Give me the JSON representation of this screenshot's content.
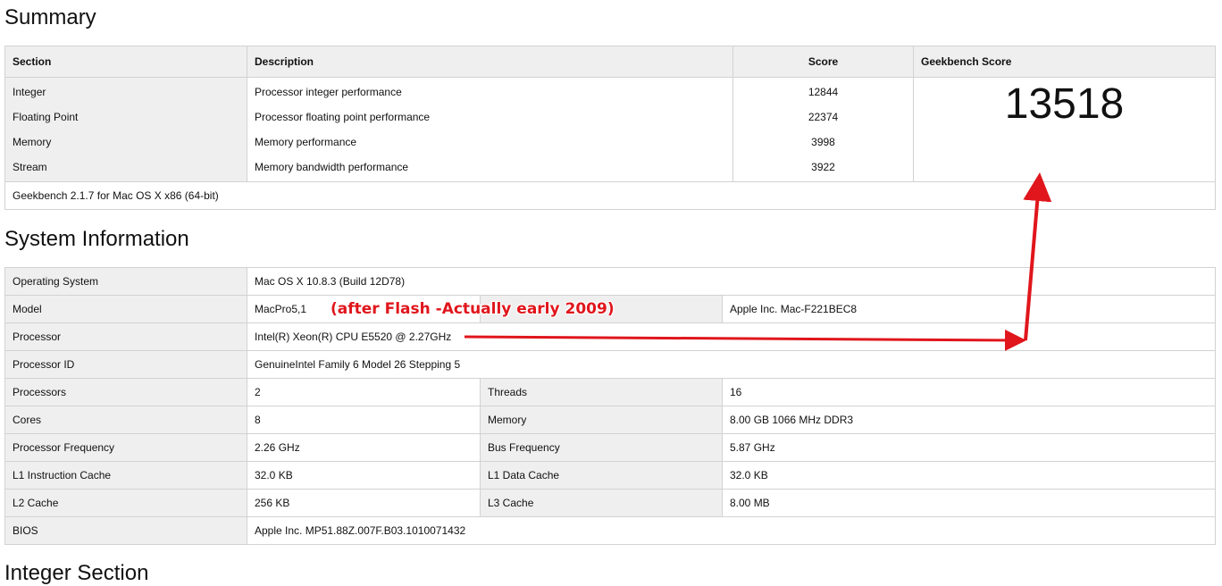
{
  "summary": {
    "heading": "Summary",
    "columns": {
      "section": "Section",
      "description": "Description",
      "score": "Score",
      "geekbench_score": "Geekbench Score"
    },
    "rows": [
      {
        "section": "Integer",
        "description": "Processor integer performance",
        "score": "12844"
      },
      {
        "section": "Floating Point",
        "description": "Processor floating point performance",
        "score": "22374"
      },
      {
        "section": "Memory",
        "description": "Memory performance",
        "score": "3998"
      },
      {
        "section": "Stream",
        "description": "Memory bandwidth performance",
        "score": "3922"
      }
    ],
    "geekbench_score": "13518",
    "footer": "Geekbench 2.1.7 for Mac OS X x86 (64-bit)"
  },
  "system_info": {
    "heading": "System Information",
    "operating_system": {
      "label": "Operating System",
      "value": "Mac OS X 10.8.3 (Build 12D78)"
    },
    "model": {
      "label": "Model",
      "value": "MacPro5,1",
      "value2": "Apple Inc. Mac-F221BEC8"
    },
    "processor": {
      "label": "Processor",
      "value": "Intel(R) Xeon(R) CPU E5520 @ 2.27GHz"
    },
    "processor_id": {
      "label": "Processor ID",
      "value": "GenuineIntel Family 6 Model 26 Stepping 5"
    },
    "pairs": [
      {
        "label": "Processors",
        "value": "2",
        "label2": "Threads",
        "value2": "16"
      },
      {
        "label": "Cores",
        "value": "8",
        "label2": "Memory",
        "value2": "8.00 GB  1066 MHz DDR3"
      },
      {
        "label": "Processor Frequency",
        "value": "2.26 GHz",
        "label2": "Bus Frequency",
        "value2": "5.87 GHz"
      },
      {
        "label": "L1 Instruction Cache",
        "value": "32.0 KB",
        "label2": "L1 Data Cache",
        "value2": "32.0 KB"
      },
      {
        "label": "L2 Cache",
        "value": "256 KB",
        "label2": "L3 Cache",
        "value2": "8.00 MB"
      }
    ],
    "bios": {
      "label": "BIOS",
      "value": "Apple Inc. MP51.88Z.007F.B03.1010071432"
    }
  },
  "integer_section": {
    "heading": "Integer Section"
  },
  "annotation": {
    "text": "(after Flash -Actually early 2009)",
    "color": "#e0161c"
  }
}
